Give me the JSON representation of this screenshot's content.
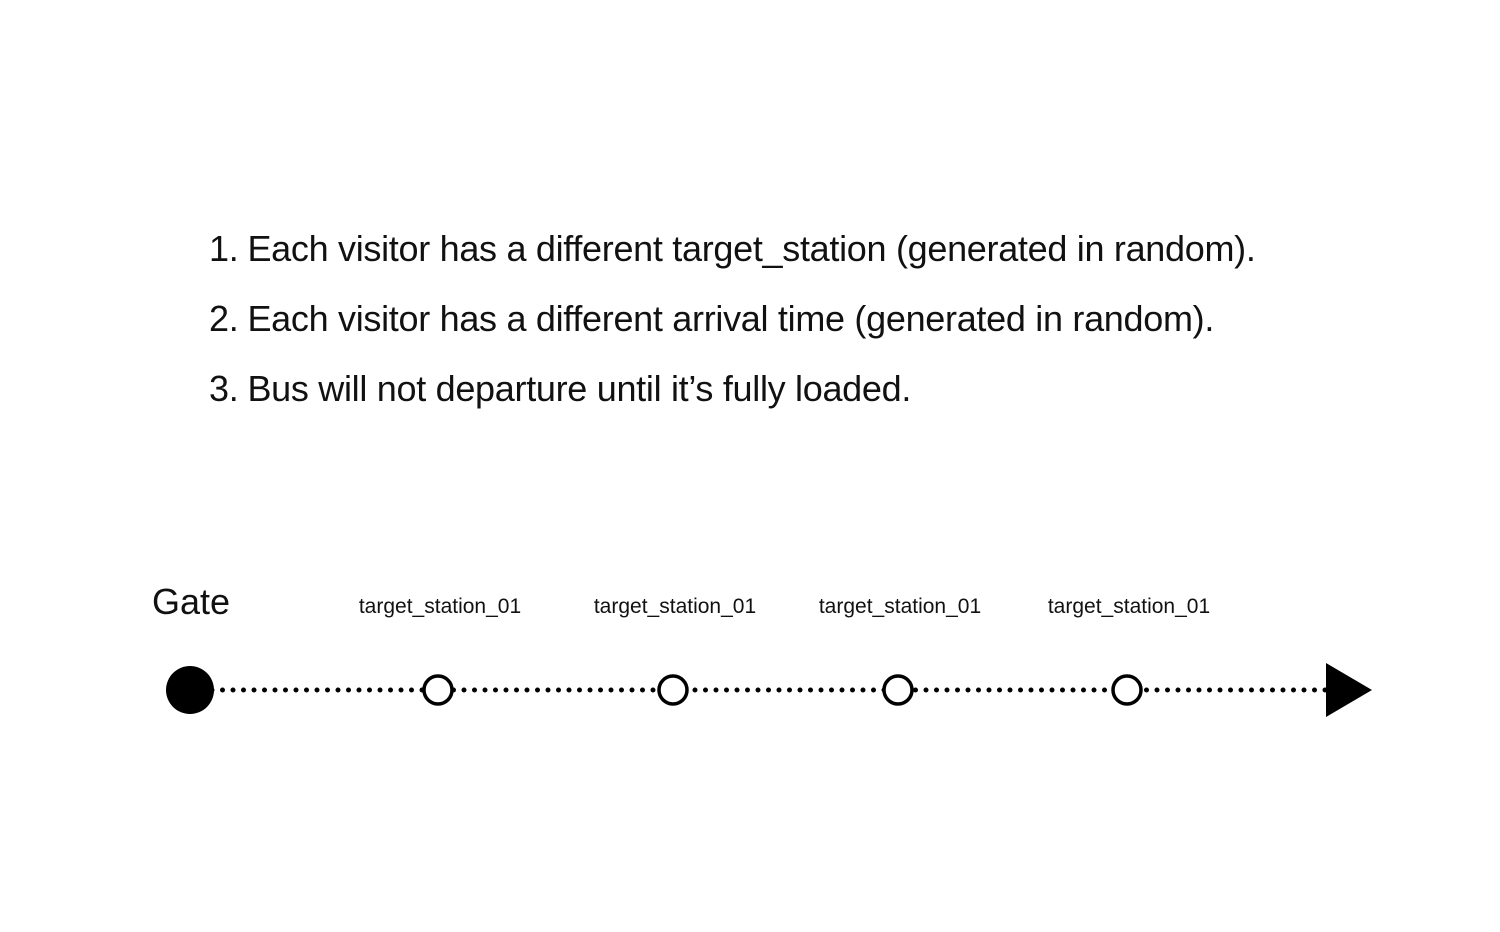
{
  "rules": [
    {
      "number": "1.",
      "text": "Each visitor has a different target_station (generated in random)."
    },
    {
      "number": "2.",
      "text": "Each visitor has a different arrival time (generated in random)."
    },
    {
      "number": "3.",
      "text": "Bus will not departure until it’s fully loaded."
    }
  ],
  "route": {
    "start_label": "Gate",
    "stations": [
      {
        "label": "target_station_01"
      },
      {
        "label": "target_station_01"
      },
      {
        "label": "target_station_01"
      },
      {
        "label": "target_station_01"
      }
    ]
  }
}
